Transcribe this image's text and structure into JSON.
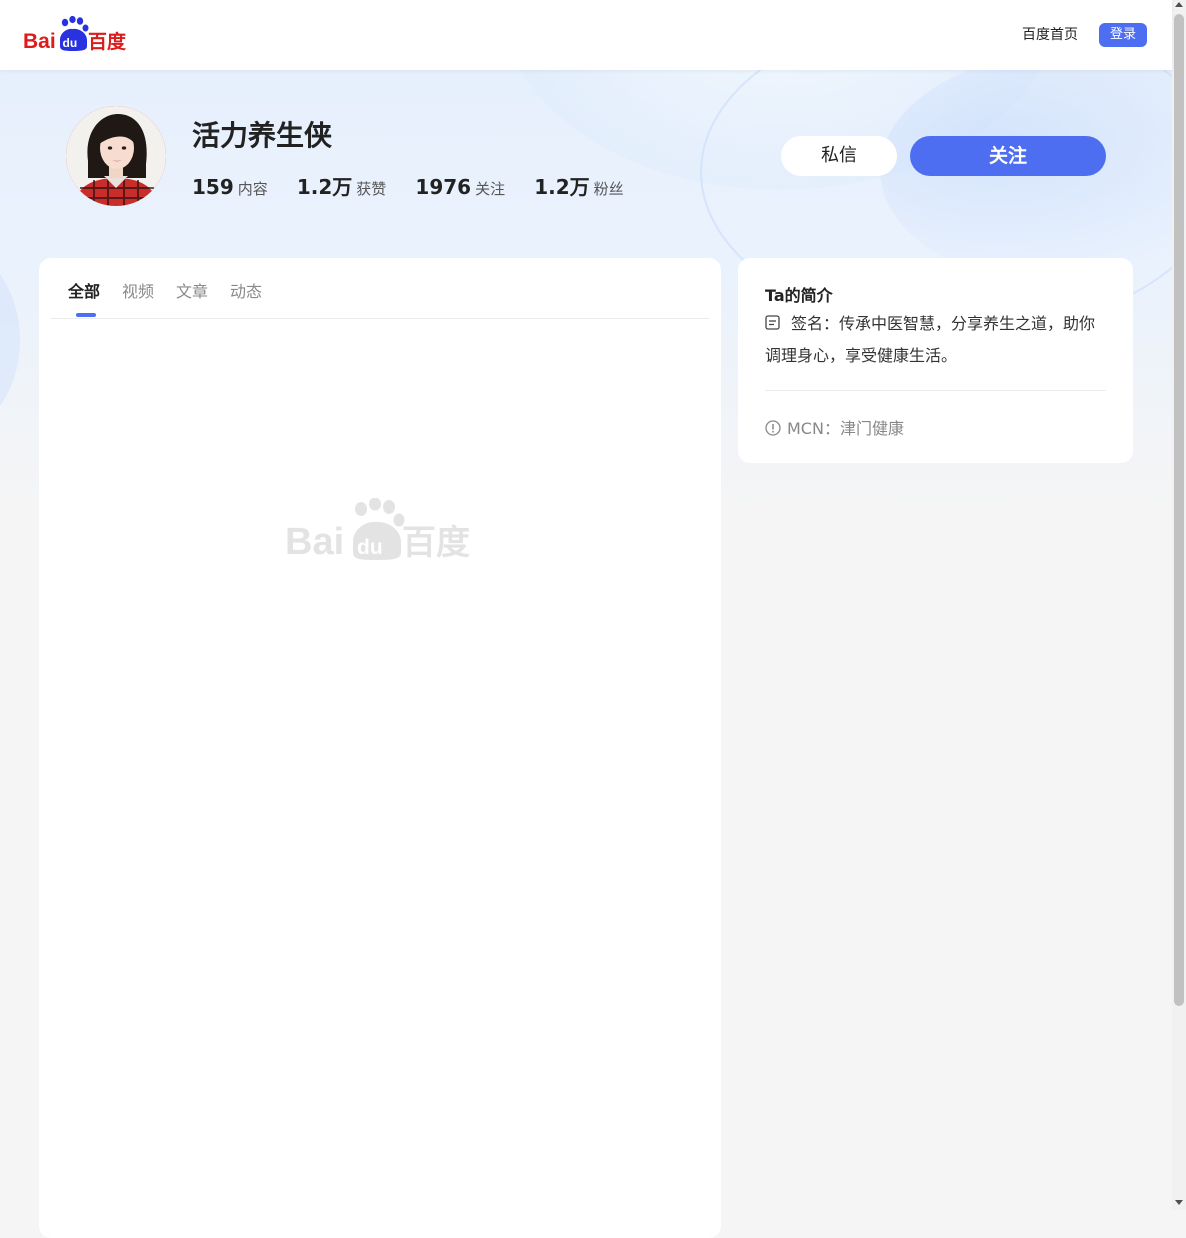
{
  "header": {
    "logo_text": "Bai du 百度",
    "home_link": "百度首页",
    "login_button": "登录"
  },
  "profile": {
    "name": "活力养生侠",
    "stats": [
      {
        "value": "159",
        "label": "内容"
      },
      {
        "value": "1.2万",
        "label": "获赞"
      },
      {
        "value": "1976",
        "label": "关注"
      },
      {
        "value": "1.2万",
        "label": "粉丝"
      }
    ],
    "message_button": "私信",
    "follow_button": "关注"
  },
  "tabs": [
    {
      "label": "全部",
      "active": true
    },
    {
      "label": "视频",
      "active": false
    },
    {
      "label": "文章",
      "active": false
    },
    {
      "label": "动态",
      "active": false
    }
  ],
  "intro": {
    "title": "Ta的简介",
    "signature": "签名：传承中医智慧，分享养生之道，助你调理身心，享受健康生活。",
    "mcn": "MCN：津门健康"
  },
  "colors": {
    "accent": "#4e6ef2",
    "brand_red": "#de1b1b",
    "brand_blue": "#2932e1"
  },
  "icons": [
    "baidu-logo",
    "signature-icon",
    "info-circle-icon"
  ]
}
